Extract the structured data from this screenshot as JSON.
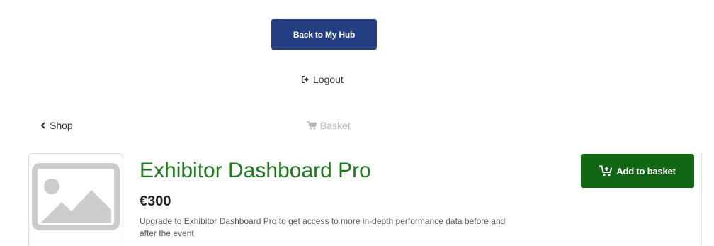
{
  "header": {
    "hub_button_label": "Back to My Hub",
    "logout_label": "Logout"
  },
  "nav": {
    "shop_label": "Shop",
    "basket_label": "Basket"
  },
  "product": {
    "title": "Exhibitor Dashboard Pro",
    "price": "€300",
    "description": "Upgrade to Exhibitor Dashboard Pro to get access to more in-depth performance data before and after the event",
    "add_to_basket_label": "Add to basket",
    "image_icon": "image-placeholder-icon"
  },
  "colors": {
    "hub_button_bg": "#233f82",
    "add_button_bg": "#116611",
    "title_color": "#1e7a1e",
    "basket_disabled": "#b8b8b8"
  }
}
